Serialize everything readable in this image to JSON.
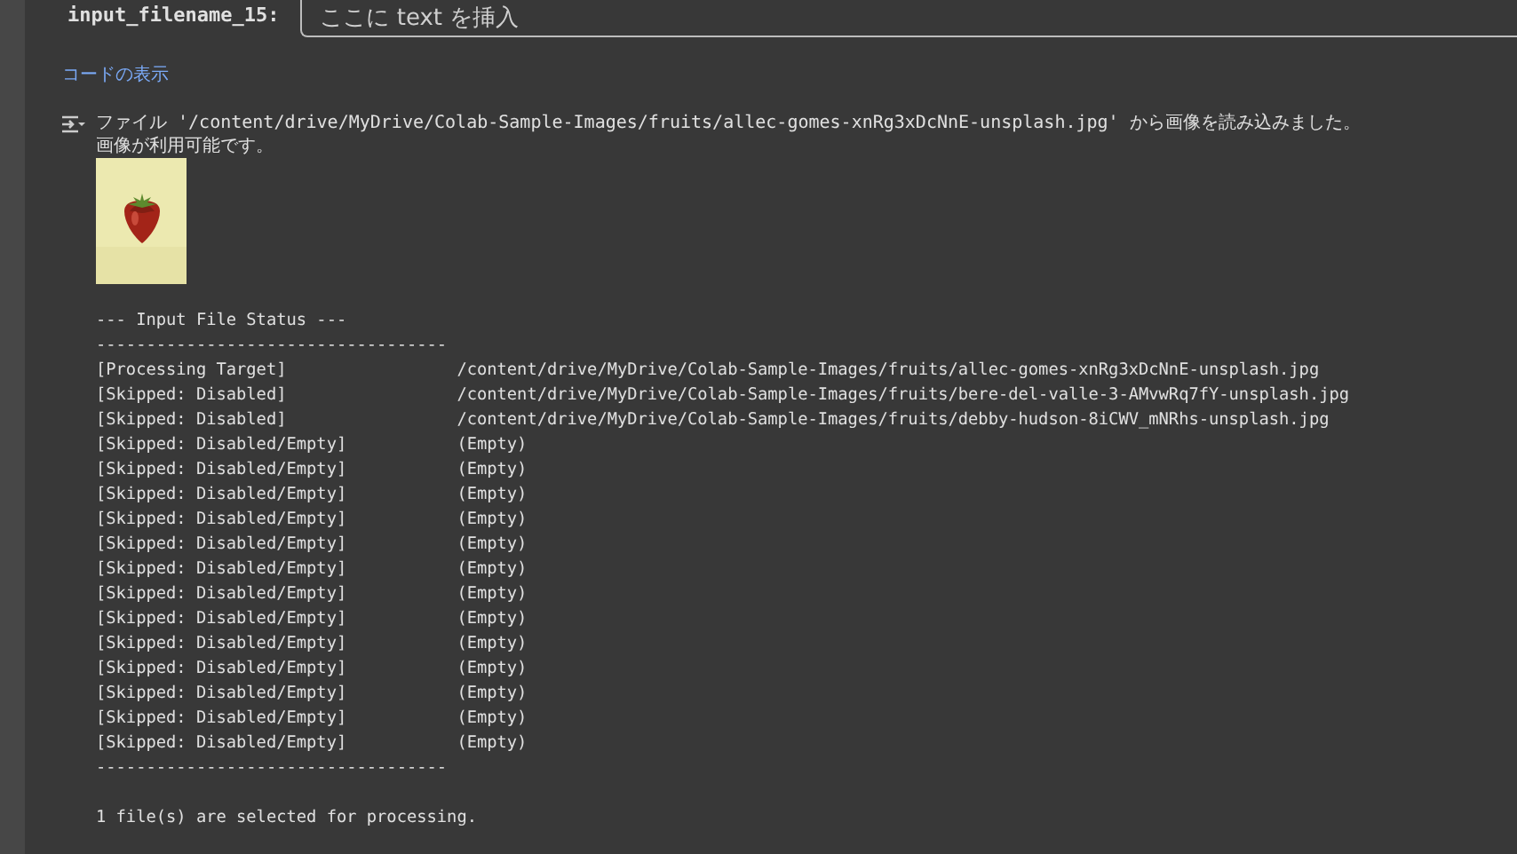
{
  "form_field": {
    "label": "input_filename_15:",
    "placeholder": "ここに text を挿入"
  },
  "code_link": "コードの表示",
  "output": {
    "message_lines": [
      "ファイル '/content/drive/MyDrive/Colab-Sample-Images/fruits/allec-gomes-xnRg3xDcNnE-unsplash.jpg' から画像を読み込みました。",
      "画像が利用可能です。"
    ],
    "status_header": "--- Input File Status ---",
    "separator_top": "-----------------------------------",
    "rows": [
      {
        "status": "[Processing Target]",
        "path": "/content/drive/MyDrive/Colab-Sample-Images/fruits/allec-gomes-xnRg3xDcNnE-unsplash.jpg"
      },
      {
        "status": "[Skipped: Disabled]",
        "path": "/content/drive/MyDrive/Colab-Sample-Images/fruits/bere-del-valle-3-AMvwRq7fY-unsplash.jpg"
      },
      {
        "status": "[Skipped: Disabled]",
        "path": "/content/drive/MyDrive/Colab-Sample-Images/fruits/debby-hudson-8iCWV_mNRhs-unsplash.jpg"
      },
      {
        "status": "[Skipped: Disabled/Empty]",
        "path": "(Empty)"
      },
      {
        "status": "[Skipped: Disabled/Empty]",
        "path": "(Empty)"
      },
      {
        "status": "[Skipped: Disabled/Empty]",
        "path": "(Empty)"
      },
      {
        "status": "[Skipped: Disabled/Empty]",
        "path": "(Empty)"
      },
      {
        "status": "[Skipped: Disabled/Empty]",
        "path": "(Empty)"
      },
      {
        "status": "[Skipped: Disabled/Empty]",
        "path": "(Empty)"
      },
      {
        "status": "[Skipped: Disabled/Empty]",
        "path": "(Empty)"
      },
      {
        "status": "[Skipped: Disabled/Empty]",
        "path": "(Empty)"
      },
      {
        "status": "[Skipped: Disabled/Empty]",
        "path": "(Empty)"
      },
      {
        "status": "[Skipped: Disabled/Empty]",
        "path": "(Empty)"
      },
      {
        "status": "[Skipped: Disabled/Empty]",
        "path": "(Empty)"
      },
      {
        "status": "[Skipped: Disabled/Empty]",
        "path": "(Empty)"
      },
      {
        "status": "[Skipped: Disabled/Empty]",
        "path": "(Empty)"
      }
    ],
    "separator_bottom": "-----------------------------------",
    "summary": "1 file(s) are selected for processing."
  }
}
